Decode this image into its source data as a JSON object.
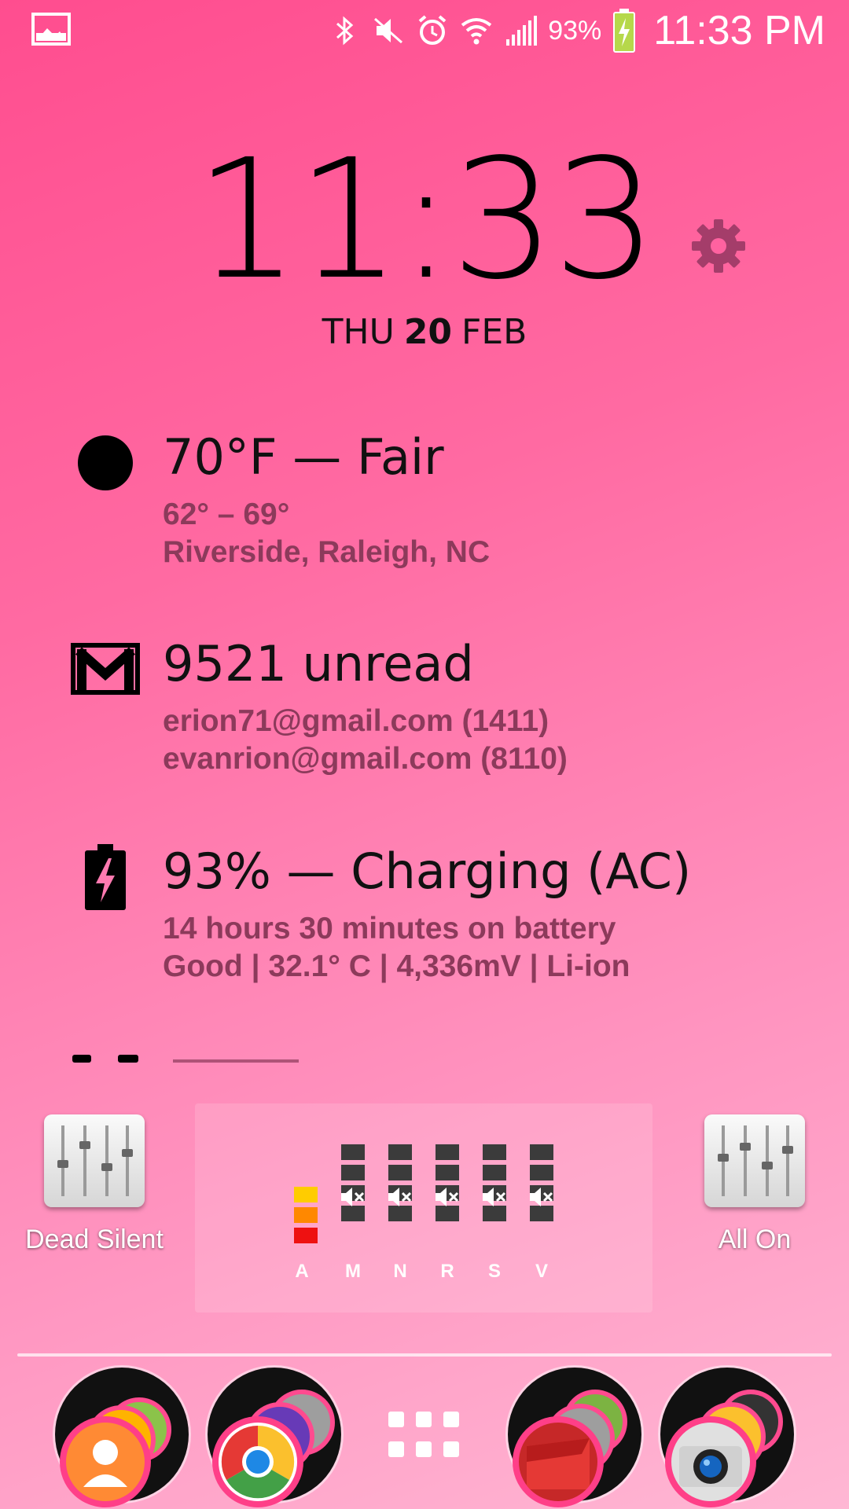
{
  "status_bar": {
    "battery_percent": "93%",
    "time": "11:33 PM",
    "icons": [
      "gallery-icon",
      "bluetooth-icon",
      "mute-icon",
      "alarm-icon",
      "wifi-icon",
      "signal-icon",
      "battery-charging-icon"
    ]
  },
  "clock": {
    "time": "11:33",
    "weekday": "THU",
    "day": "20",
    "month": "FEB"
  },
  "weather": {
    "title": "70°F — Fair",
    "range": "62° – 69°",
    "location": "Riverside, Raleigh, NC"
  },
  "mail": {
    "title": "9521 unread",
    "account1": "erion71@gmail.com (1411)",
    "account2": "evanrion@gmail.com (8110)"
  },
  "battery": {
    "title": "93% — Charging (AC)",
    "estimate": "14 hours 30 minutes on battery",
    "details": "Good | 32.1° C | 4,336mV | Li-ion"
  },
  "sound_profiles": {
    "left_label": "Dead Silent",
    "right_label": "All On"
  },
  "volume": {
    "labels": [
      "A",
      "M",
      "N",
      "R",
      "S",
      "V"
    ]
  },
  "colors": {
    "accent": "#ff3f88",
    "sub_text": "#8c3a5b"
  }
}
